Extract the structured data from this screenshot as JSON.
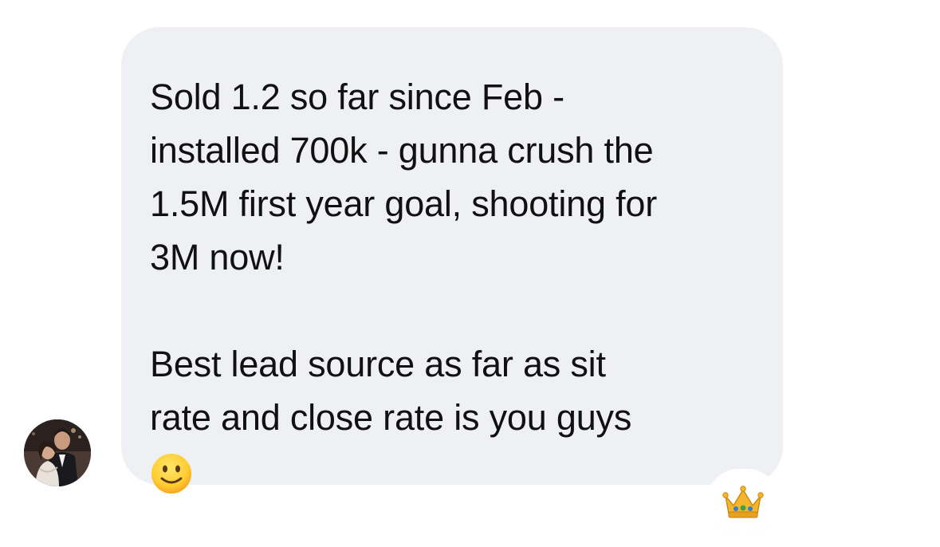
{
  "conversation": {
    "message": {
      "lines": [
        "Sold 1.2 so far since Feb -",
        "installed 700k - gunna crush the",
        "1.5M first year goal, shooting for",
        "3M now!"
      ],
      "lines2": [
        "Best lead source as far as sit",
        "rate and close rate is you guys"
      ],
      "emoji": "slightly-smiling-face"
    },
    "sender": {
      "avatar_icon": "profile-photo"
    },
    "reaction": {
      "emoji": "crown-icon"
    }
  },
  "colors": {
    "bubble": "#eff0f4",
    "text": "#111111",
    "background": "#ffffff"
  }
}
